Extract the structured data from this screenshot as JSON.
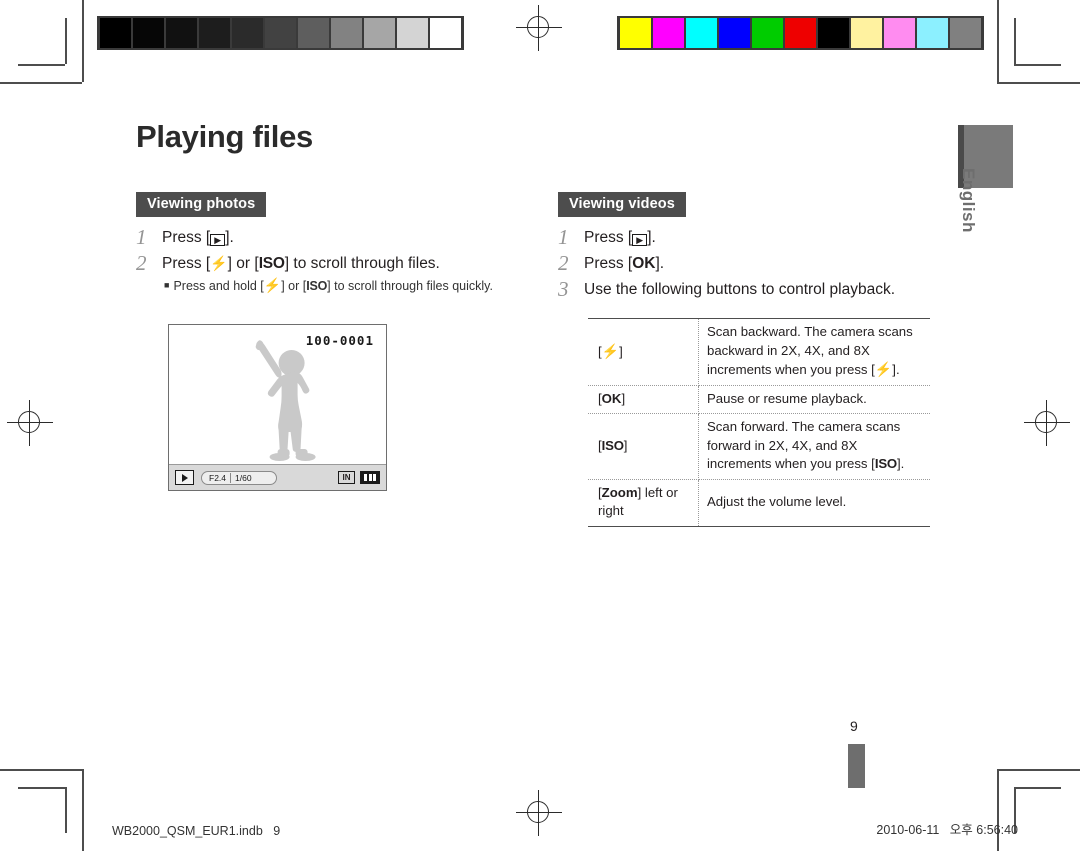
{
  "page_title": "Playing files",
  "language_tab": "English",
  "page_number": "9",
  "footer": {
    "left": "WB2000_QSM_EUR1.indb   9",
    "right": "2010-06-11   오후 6:56:40"
  },
  "calibration": {
    "gray_bar": [
      "#000000",
      "#060606",
      "#111111",
      "#1d1d1d",
      "#2b2b2b",
      "#424242",
      "#5e5e5e",
      "#828282",
      "#a6a6a6",
      "#d4d4d4",
      "#ffffff"
    ],
    "color_bar": [
      "#ffff00",
      "#ff00ff",
      "#00ffff",
      "#0000ff",
      "#00cc00",
      "#ee0000",
      "#000000",
      "#fff2a0",
      "#ff8cf0",
      "#8cf0ff",
      "#808080"
    ]
  },
  "left_column": {
    "section_tag": "Viewing photos",
    "steps": [
      {
        "num": "1",
        "text_before": "Press [",
        "key": "play-icon",
        "text_after": "]."
      },
      {
        "num": "2",
        "text_after": " to scroll through files."
      }
    ],
    "step2_prefix": "Press [",
    "step2_mid": "] or [",
    "step2_suffix": "] to scroll through files.",
    "step2_key1": "⚡",
    "step2_key2": "ISO",
    "sub_note_prefix": "Press and hold [",
    "sub_note_mid": "] or [",
    "sub_note_suffix": "] to scroll through files quickly.",
    "lcd": {
      "file_number": "100-0001",
      "aperture": "F2.4",
      "shutter": "1/60",
      "memory": "IN",
      "play_label": "play-icon",
      "battery_label": "battery-full-icon"
    }
  },
  "right_column": {
    "section_tag": "Viewing videos",
    "steps": [
      {
        "num": "1",
        "prefix": "Press [",
        "key": "play-icon",
        "suffix": "]."
      },
      {
        "num": "2",
        "prefix": "Press [",
        "key": "OK",
        "suffix": "]."
      },
      {
        "num": "3",
        "prefix": "Use the following buttons to control playback.",
        "key": "",
        "suffix": ""
      }
    ],
    "table": {
      "rows": [
        {
          "key_prefix": "[",
          "key": "⚡",
          "key_suffix": "]",
          "key_style": "flash",
          "desc_parts": [
            "Scan backward. The camera scans backward in 2X, 4X, and 8X increments when you press [",
            "⚡",
            "]."
          ]
        },
        {
          "key_prefix": "[",
          "key": "OK",
          "key_suffix": "]",
          "key_style": "bold",
          "desc_parts": [
            "Pause or resume playback.",
            "",
            ""
          ]
        },
        {
          "key_prefix": "[",
          "key": "ISO",
          "key_suffix": "]",
          "key_style": "bold",
          "desc_parts": [
            "Scan forward. The camera scans forward in 2X, 4X, and 8X increments when you press [",
            "ISO",
            "]."
          ]
        },
        {
          "key_prefix": "[",
          "key": "Zoom",
          "key_suffix": "] left or right",
          "key_style": "bold",
          "desc_parts": [
            "Adjust the volume level.",
            "",
            ""
          ]
        }
      ]
    }
  }
}
